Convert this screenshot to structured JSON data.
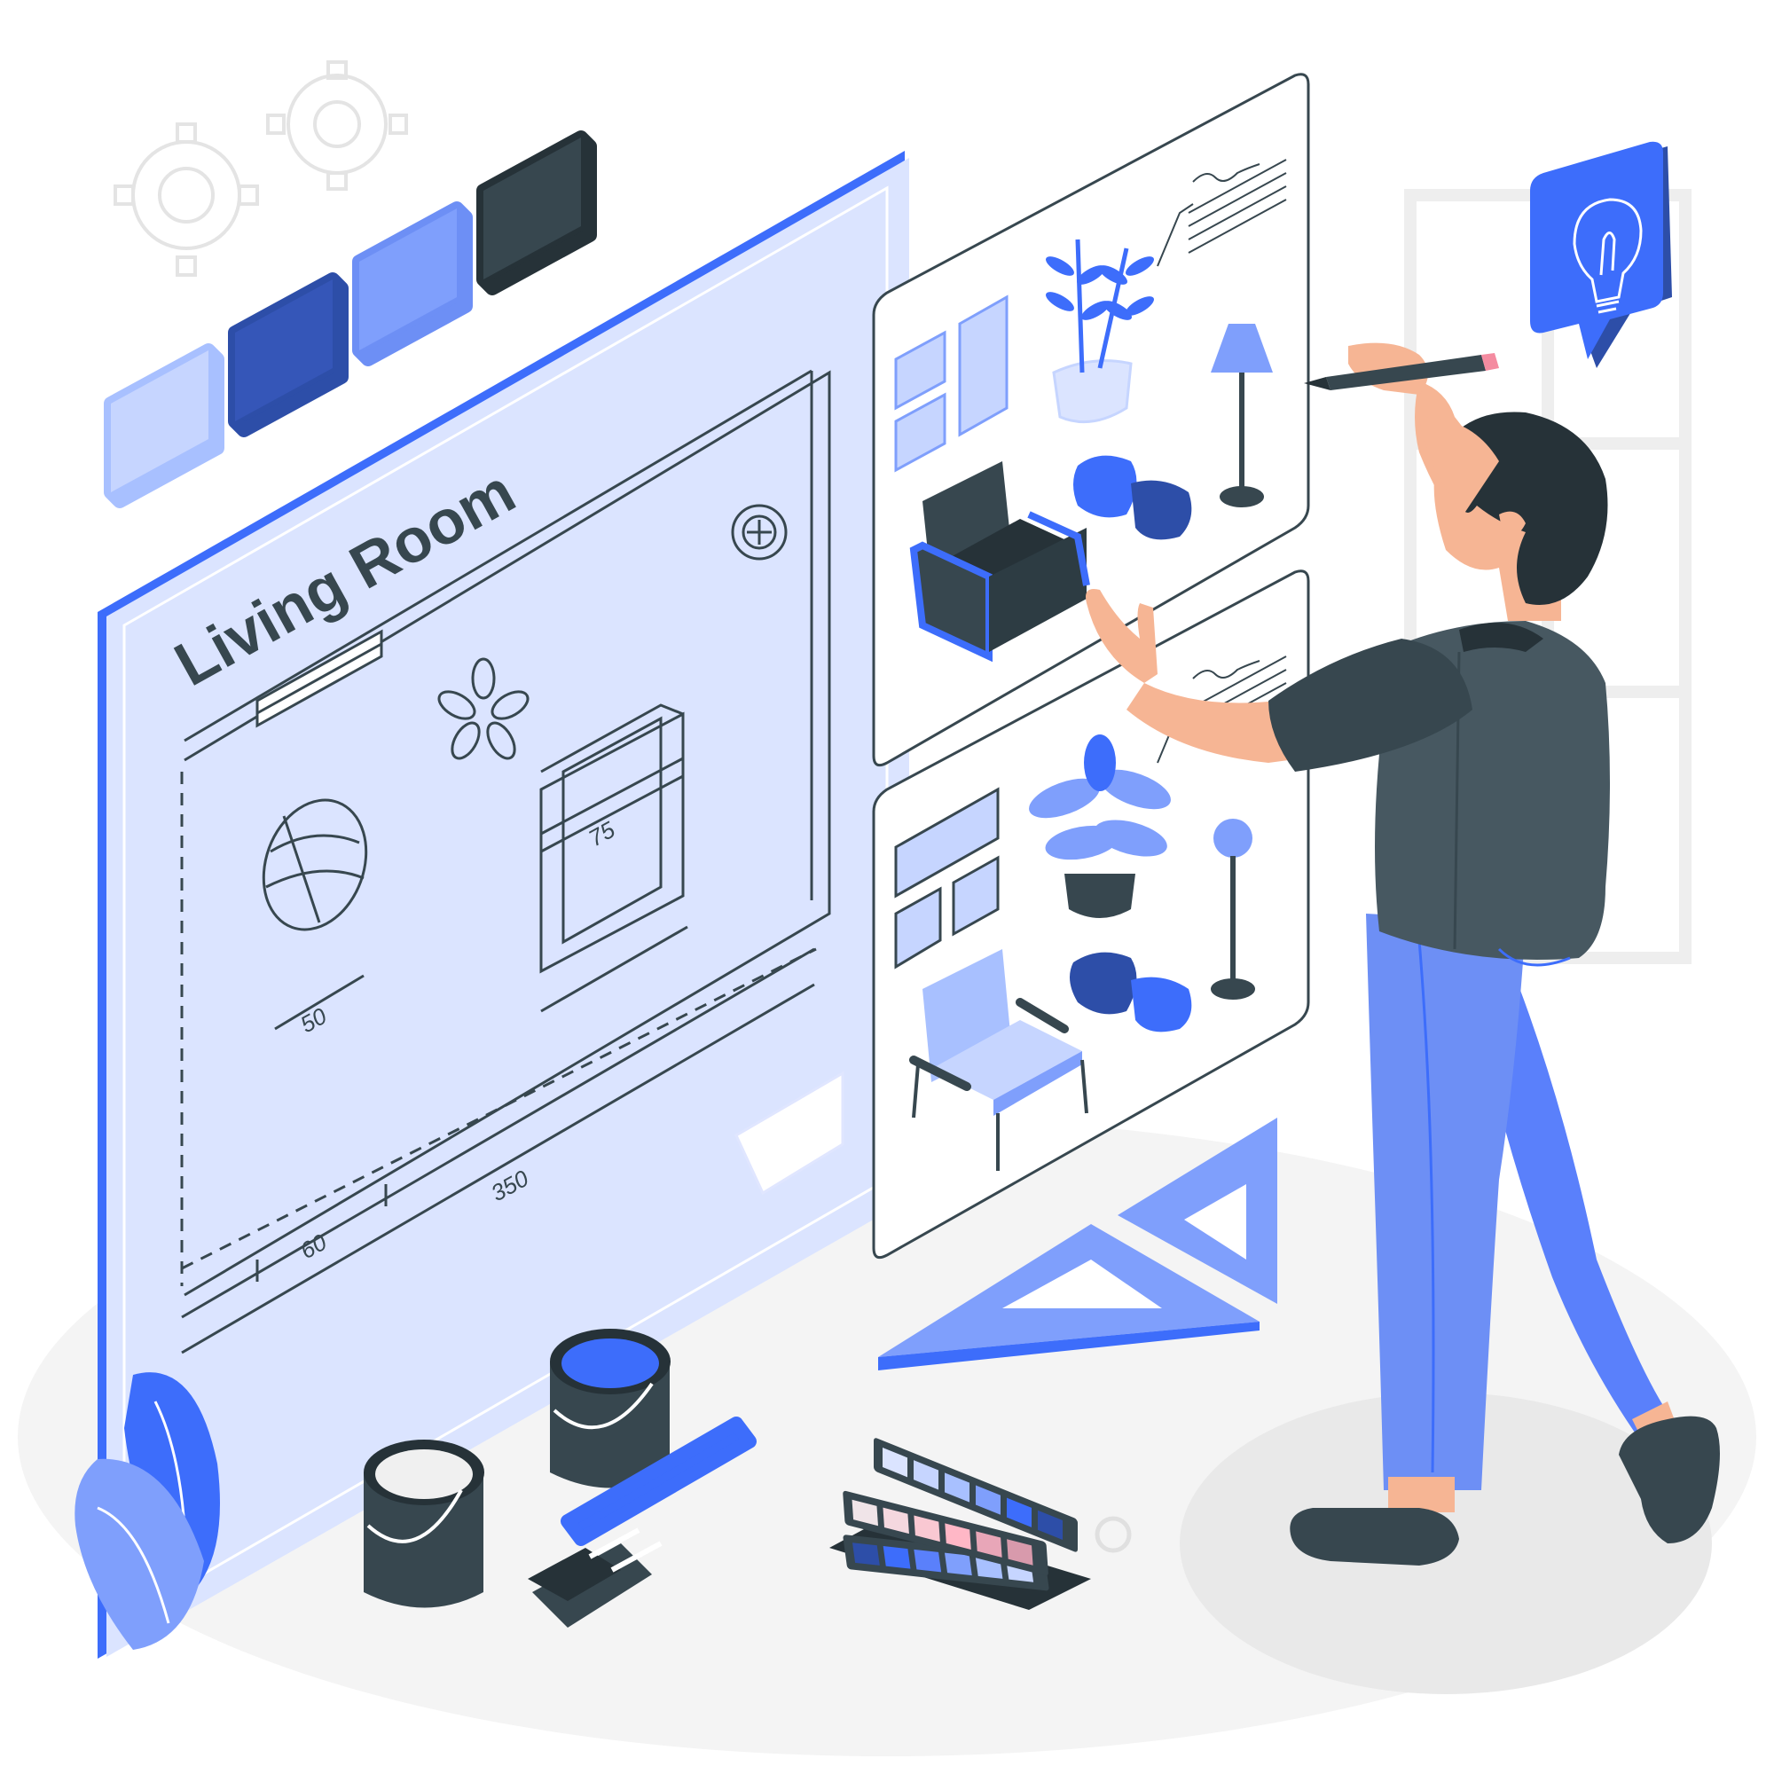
{
  "floor_plan": {
    "title": "Living Room",
    "dimensions": {
      "rug_width": "50",
      "sofa_width": "75",
      "offset": "60",
      "room_length": "350"
    }
  },
  "palette_swatches": [
    "#a8c0ff",
    "#2d4ea8",
    "#7f9ffc",
    "#37474f"
  ],
  "mood_boards": [
    {
      "name": "board-dark-armchair",
      "accent": "#3e6bff"
    },
    {
      "name": "board-light-armchair",
      "accent": "#7f9ffc"
    }
  ],
  "colors": {
    "accent": "#3d6dfb",
    "dark": "#37474f",
    "light_blue": "#dbe4ff",
    "mid_blue": "#7f9ffc",
    "skin": "#f6b594"
  },
  "icons": {
    "idea": "lightbulb-icon",
    "settings": "gear-icon"
  }
}
